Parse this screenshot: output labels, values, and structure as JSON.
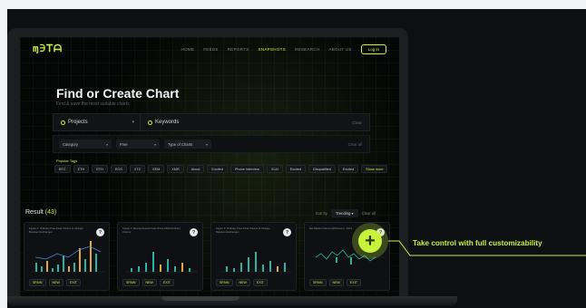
{
  "nav": {
    "logo": "ɱ∋ꓔᗩ",
    "links": [
      "HOME",
      "FEEDS",
      "REPORTS",
      "SNAPSHOTS",
      "RESEARCH",
      "ABOUT US"
    ],
    "active_link": "SNAPSHOTS",
    "login": "Log in"
  },
  "hero": {
    "title": "Find or Create Chart",
    "subtitle": "Find & save the most suitable charts"
  },
  "search": {
    "projects_label": "Projects",
    "keywords_label": "Keywords",
    "clear": "Clear"
  },
  "filters": {
    "category": "Category",
    "free": "Free",
    "type": "Type of Charts",
    "clear": "Clear all"
  },
  "tags": {
    "label": "Popular Tags",
    "items": [
      "BTC",
      "ETH",
      "ETH",
      "EOS",
      "XTZ",
      "XEM",
      "XMR",
      "Aloud",
      "Excited",
      "Phone interview",
      "XLM",
      "Excited",
      "Disqualified",
      "Excited"
    ],
    "more": "Show more"
  },
  "results": {
    "label": "Result",
    "count": "(43)",
    "sort_label": "Sort by",
    "sort_value": "Trending",
    "clear": "Clear all"
  },
  "cards": [
    {
      "title": "Figure 1: Ordinary Free-Float Volume & Change Between Exchanges",
      "buttons": [
        "SPAIN",
        "NEW",
        "EXIT"
      ]
    },
    {
      "title": "Figure 2: Moving Excess Fees Since 2020 Ordinary Volume",
      "buttons": [
        "SPAIN",
        "NEW",
        "EXIT"
      ]
    },
    {
      "title": "Figure 3: Ordinary Free-Float Volume & Change Between Exchanges",
      "buttons": [
        "SPAIN",
        "NEW",
        "EXIT"
      ]
    },
    {
      "title": "Net Market Volume (Ethereum) - 2021",
      "buttons": [
        "SPAIN",
        "NEW",
        "EXIT"
      ]
    }
  ],
  "cta": {
    "text": "Take control with full customizability",
    "accent": "#c8f23a"
  }
}
